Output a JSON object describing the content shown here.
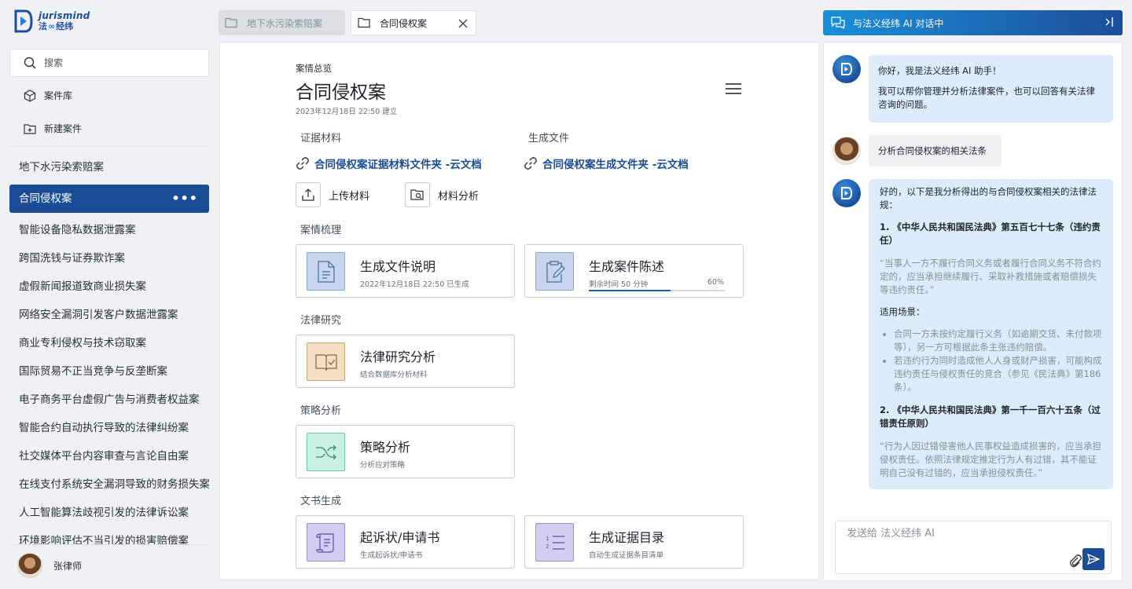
{
  "brand": {
    "name_en": "jurismind",
    "name_cn_left": "法",
    "name_cn_loop": "∞",
    "name_cn_right": "经纬"
  },
  "sidebar": {
    "search_placeholder": "搜索",
    "case_library": "案件库",
    "new_case": "新建案件",
    "pinned_case": "地下水污染索赔案",
    "active_case": "合同侵权案",
    "active_more": "•••",
    "cases": [
      "智能设备隐私数据泄露案",
      "跨国洗钱与证券欺诈案",
      "虚假新闻报道致商业损失案",
      "网络安全漏洞引发客户数据泄露案",
      "商业专利侵权与技术窃取案",
      "国际贸易不正当竞争与反垄断案",
      "电子商务平台虚假广告与消费者权益案",
      "智能合约自动执行导致的法律纠纷案",
      "社交媒体平台内容审查与言论自由案",
      "在线支付系统安全漏洞导致的财务损失案",
      "人工智能算法歧视引发的法律诉讼案",
      "环境影响评估不当引发的损害赔偿案"
    ],
    "user_name": "张律师"
  },
  "tabs": [
    {
      "label": "地下水污染索赔案"
    },
    {
      "label": "合同侵权案"
    }
  ],
  "overview": {
    "crumb": "案情总览",
    "title": "合同侵权案",
    "created": "2023年12月18日 22:50 建立",
    "evidence_label": "证据材料",
    "evidence_link": "合同侵权案证据材料文件夹 -云文档",
    "generated_label": "生成文件",
    "generated_link": "合同侵权案生成文件夹 -云文档",
    "upload_label": "上传材料",
    "analyze_label": "材料分析",
    "sections": {
      "case_review": "案情梳理",
      "legal_research": "法律研究",
      "strategy": "策略分析",
      "docs": "文书生成"
    },
    "cards": {
      "file_desc": {
        "title": "生成文件说明",
        "sub": "2022年12月18日 22:50 已生成"
      },
      "case_statement": {
        "title": "生成案件陈述",
        "sub": "剩余时间 50 分钟",
        "pct_label": "60%",
        "progress": 0.6
      },
      "legal_analysis": {
        "title": "法律研究分析",
        "sub": "结合数据库分析材料"
      },
      "strategy": {
        "title": "策略分析",
        "sub": "分析应对策略"
      },
      "complaint": {
        "title": "起诉状/申请书",
        "sub": "生成起诉状/申请书"
      },
      "evidence_list": {
        "title": "生成证据目录",
        "sub": "自动生成证据条目清单"
      }
    }
  },
  "chat": {
    "header": "与法义经纬 AI 对话中",
    "msg1_l1": "你好，我是法义经纬 AI 助手！",
    "msg1_l2": "我可以帮你管理并分析法律案件，也可以回答有关法律咨询的问题。",
    "msg2": "分析合同侵权案的相关法条",
    "msg3_intro": "好的，以下是我分析得出的与合同侵权案相关的法律法规：",
    "law1_title": "1. 《中华人民共和国民法典》第五百七十七条（违约责任）",
    "law1_quote": "“当事人一方不履行合同义务或者履行合同义务不符合约定的，应当承担继续履行、采取补救措施或者赔偿损失等违约责任。”",
    "scenario_label": "适用场景：",
    "scenario_1": "合同一方未按约定履行义务（如逾期交货、未付款项等），另一方可根据此条主张违约赔偿。",
    "scenario_2": "若违约行为同时造成他人人身或财产损害，可能构成违约责任与侵权责任的竞合（参见《民法典》第186条）。",
    "law2_title": "2. 《中华人民共和国民法典》第一千一百六十五条（过错责任原则）",
    "law2_quote": "“行为人因过错侵害他人民事权益造成损害的，应当承担侵权责任。依照法律规定推定行为人有过错，其不能证明自己没有过错的，应当承担侵权责任。”",
    "composer_placeholder": "发送给 法义经纬 AI"
  },
  "colors": {
    "brand": "#1b4d96",
    "accent": "#1a8fd8",
    "bubble_ai": "#dcecfb",
    "bubble_user": "#f0f1f3"
  }
}
